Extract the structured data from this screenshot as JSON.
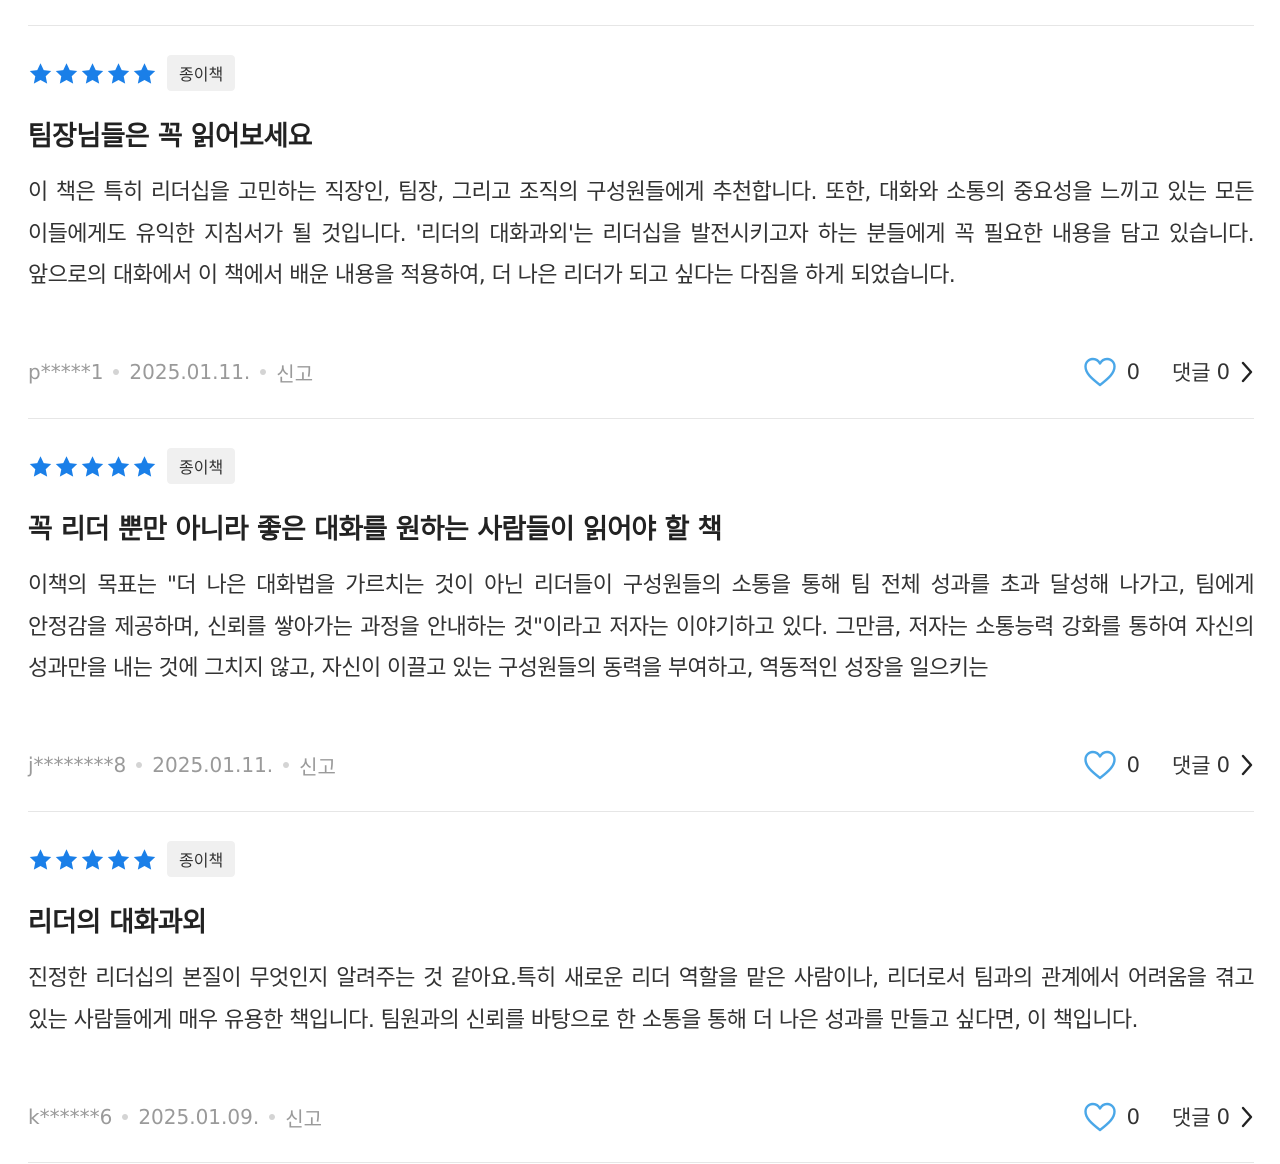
{
  "colors": {
    "star": "#1a7fe8",
    "heart": "#4aa7e8",
    "divider": "#e6e6e6",
    "badge_bg": "#f0f0f0",
    "meta_text": "#9a9a9a"
  },
  "icons": {
    "rating_star": "star-icon",
    "like": "heart-icon",
    "comment_arrow": "chevron-right-icon"
  },
  "reviews": [
    {
      "rating": 5,
      "badge": "종이책",
      "title": "팀장님들은 꼭 읽어보세요",
      "body": "이 책은 특히 리더십을 고민하는 직장인, 팀장, 그리고 조직의 구성원들에게 추천합니다. 또한, 대화와 소통의 중요성을 느끼고 있는 모든 이들에게도 유익한 지침서가 될 것입니다. '리더의 대화과외'는 리더십을 발전시키고자 하는 분들에게 꼭 필요한 내용을 담고 있습니다. 앞으로의 대화에서 이 책에서 배운 내용을 적용하여, 더 나은 리더가 되고 싶다는 다짐을 하게 되었습니다.",
      "author": "p*****1",
      "date": "2025.01.11.",
      "report": "신고",
      "likes": "0",
      "comment_label": "댓글",
      "comments": "0"
    },
    {
      "rating": 5,
      "badge": "종이책",
      "title": "꼭 리더 뿐만 아니라 좋은 대화를 원하는 사람들이 읽어야 할 책",
      "body": "이책의 목표는 \"더 나은 대화법을 가르치는 것이 아닌 리더들이 구성원들의 소통을 통해 팀 전체 성과를 초과 달성해 나가고,  팀에게 안정감을 제공하며, 신뢰를 쌓아가는 과정을 안내하는 것\"이라고 저자는 이야기하고 있다. 그만큼, 저자는 소통능력 강화를 통하여 자신의 성과만을 내는 것에 그치지 않고, 자신이 이끌고 있는 구성원들의 동력을 부여하고, 역동적인 성장을 일으키는",
      "author": "j********8",
      "date": "2025.01.11.",
      "report": "신고",
      "likes": "0",
      "comment_label": "댓글",
      "comments": "0"
    },
    {
      "rating": 5,
      "badge": "종이책",
      "title": "리더의 대화과외",
      "body": "진정한 리더십의 본질이 무엇인지 알려주는 것 같아요.특히 새로운 리더 역할을 맡은 사람이나, 리더로서 팀과의 관계에서 어려움을 겪고 있는 사람들에게 매우 유용한 책입니다. 팀원과의 신뢰를 바탕으로 한 소통을 통해 더 나은 성과를 만들고 싶다면, 이 책입니다.",
      "author": "k******6",
      "date": "2025.01.09.",
      "report": "신고",
      "likes": "0",
      "comment_label": "댓글",
      "comments": "0"
    }
  ]
}
